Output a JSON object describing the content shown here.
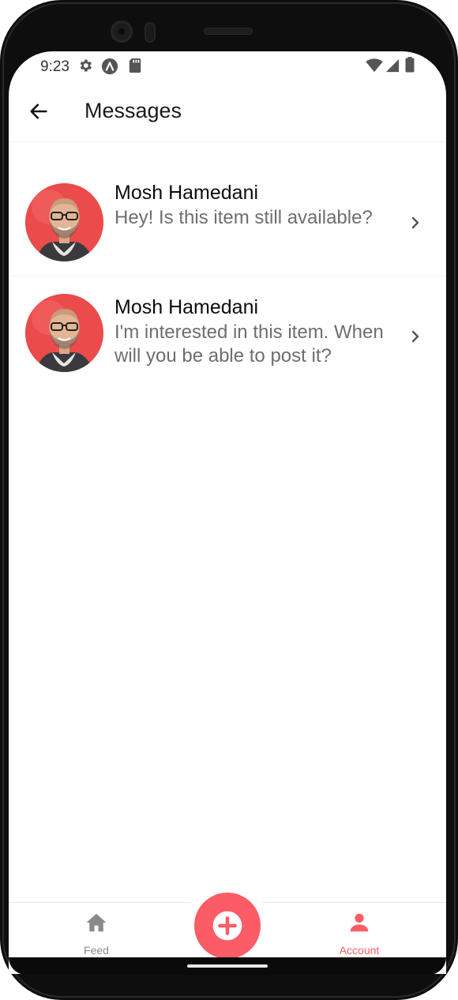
{
  "status_bar": {
    "time": "9:23",
    "left_icons": [
      "gear-icon",
      "app-badge-icon",
      "sd-card-icon"
    ],
    "right_icons": [
      "wifi-icon",
      "cell-signal-icon",
      "battery-icon"
    ]
  },
  "header": {
    "back_icon": "arrow-left-icon",
    "title": "Messages"
  },
  "messages": [
    {
      "name": "Mosh Hamedani",
      "body": "Hey! Is this item still available?",
      "chevron": "chevron-right-icon"
    },
    {
      "name": "Mosh Hamedani",
      "body": "I'm interested in this item. When will you be able to post it?",
      "chevron": "chevron-right-icon"
    }
  ],
  "tabbar": {
    "tabs": [
      {
        "label": "Feed",
        "icon": "home-icon",
        "active": false
      },
      {
        "label": "Account",
        "icon": "account-icon",
        "active": true
      }
    ],
    "center_button_icon": "plus-circle-icon"
  },
  "colors": {
    "primary": "#fc5c65",
    "inactive": "#8a8a8a",
    "text_dark": "#0c0c0c",
    "text_muted": "#6e6e6e"
  }
}
